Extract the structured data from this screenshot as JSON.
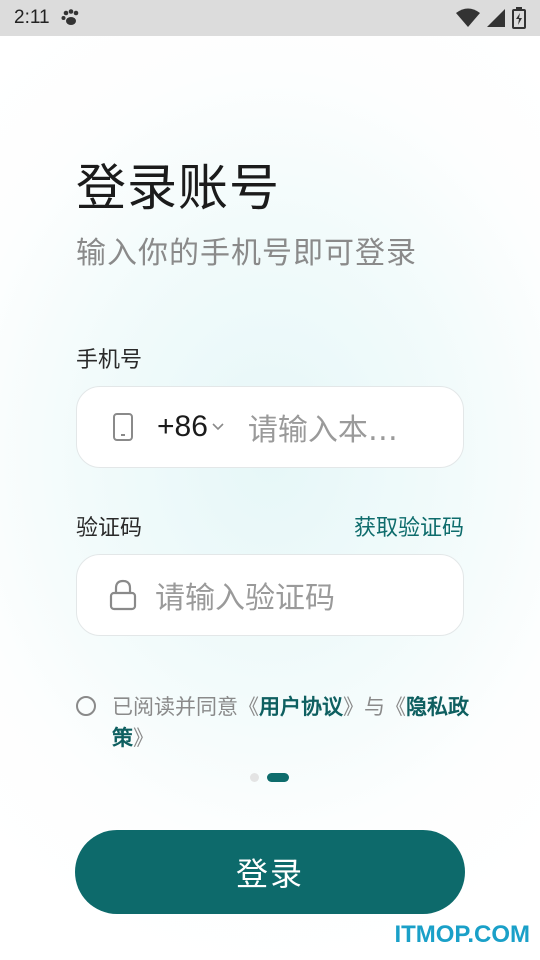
{
  "status_bar": {
    "time": "2:11",
    "icons": [
      "paw-icon",
      "wifi-icon",
      "signal-icon",
      "battery-icon"
    ]
  },
  "header": {
    "title": "登录账号",
    "subtitle": "输入你的手机号即可登录"
  },
  "phone": {
    "label": "手机号",
    "country_code": "+86",
    "placeholder": "请输入本…"
  },
  "code": {
    "label": "验证码",
    "get_code_label": "获取验证码",
    "placeholder": "请输入验证码"
  },
  "agreement": {
    "prefix": "已阅读并同意《",
    "user_agreement": "用户协议",
    "middle": "》与《",
    "privacy_policy": "隐私政策",
    "suffix": "》"
  },
  "pager": {
    "count": 2,
    "active_index": 1
  },
  "login_button": {
    "label": "登录"
  },
  "watermark": "ITMOP.COM",
  "colors": {
    "accent": "#0d6a6b",
    "link": "#0e5f60",
    "watermark": "#1aa0c8"
  }
}
